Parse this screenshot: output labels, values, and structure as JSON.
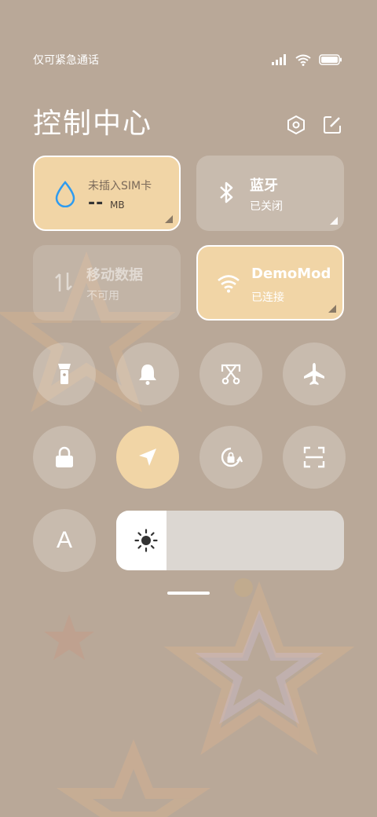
{
  "status_bar": {
    "carrier_text": "仅可紧急通话",
    "icons": [
      "signal-icon",
      "wifi-icon",
      "battery-icon"
    ]
  },
  "header": {
    "title": "控制中心",
    "settings_icon": "settings-hexagon-icon",
    "edit_icon": "edit-icon"
  },
  "tiles": {
    "data_usage": {
      "label": "未插入SIM卡",
      "value": "--",
      "unit": "MB",
      "icon": "water-drop-icon",
      "active": true
    },
    "bluetooth": {
      "title": "蓝牙",
      "status": "已关闭",
      "icon": "bluetooth-icon",
      "active": false
    },
    "mobile_data": {
      "title": "移动数据",
      "status": "不可用",
      "icon": "data-arrows-icon",
      "active": false
    },
    "wifi": {
      "title": "DemoMod",
      "status": "已连接",
      "icon": "wifi-icon",
      "active": true
    }
  },
  "toggles_row1": [
    {
      "name": "flashlight-icon",
      "active": false
    },
    {
      "name": "bell-icon",
      "active": false
    },
    {
      "name": "screenshot-scissors-icon",
      "active": false
    },
    {
      "name": "airplane-icon",
      "active": false
    }
  ],
  "toggles_row2": [
    {
      "name": "lock-icon",
      "active": false
    },
    {
      "name": "location-arrow-icon",
      "active": true
    },
    {
      "name": "rotation-lock-icon",
      "active": false
    },
    {
      "name": "scan-icon",
      "active": false
    }
  ],
  "font_size_button": {
    "label": "A"
  },
  "brightness": {
    "level_percent": 22,
    "icon": "sun-icon"
  },
  "colors": {
    "background": "#b9a898",
    "active_tile": "#f1d5a6",
    "accent_blue": "#2d9bf0"
  }
}
